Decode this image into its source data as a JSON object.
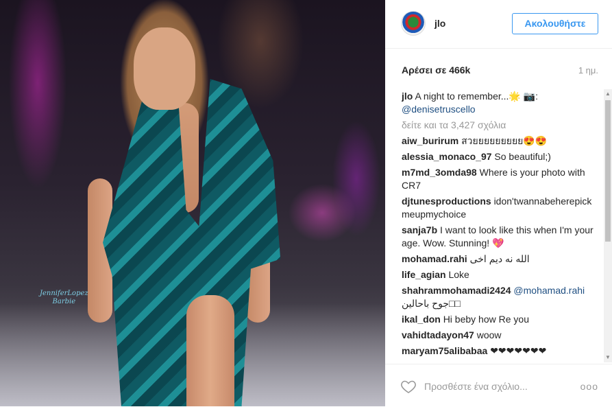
{
  "post": {
    "username": "jlo",
    "follow_label": "Ακολουθήστε",
    "likes": "Αρέσει σε 466k",
    "time": "1 ημ.",
    "watermark": [
      "JenniferLopez",
      "Barbie"
    ]
  },
  "caption": {
    "user": "jlo",
    "text": "A night to remember...🌟 📷:",
    "mention": "@denisetruscello"
  },
  "view_all": "δείτε και τα 3,427 σχόλια",
  "comments": [
    {
      "user": "aiw_burirum",
      "text": "สวยยยยยยยยย😍😍"
    },
    {
      "user": "alessia_monaco_97",
      "text": "So beautiful;)"
    },
    {
      "user": "m7md_3omda98",
      "text": "Where is your photo with CR7"
    },
    {
      "user": "djtunesproductions",
      "text": "idon'twannabeherepickmeupmychoice"
    },
    {
      "user": "sanja7b",
      "text": "I want to look like this when I'm your age. Wow. Stunning! 💖"
    },
    {
      "user": "mohamad.rahi",
      "text": "الله نه دیم اخی"
    },
    {
      "user": "life_agian",
      "text": "Loke"
    },
    {
      "user": "shahrammohamadi2424",
      "text_mention": "@mohamad.rahi",
      "text": "جوح باحالین□□"
    },
    {
      "user": "ikal_don",
      "text": "Hi beby how Re you"
    },
    {
      "user": "vahidtadayon47",
      "text": "woow"
    },
    {
      "user": "maryam75alibabaa",
      "text": "❤❤❤❤❤❤❤"
    }
  ],
  "footer": {
    "add_comment_placeholder": "Προσθέστε ένα σχόλιο...",
    "more": "ooo"
  },
  "icons": {
    "heart": "heart-icon",
    "avatar": "avatar",
    "more": "more-options-icon"
  }
}
